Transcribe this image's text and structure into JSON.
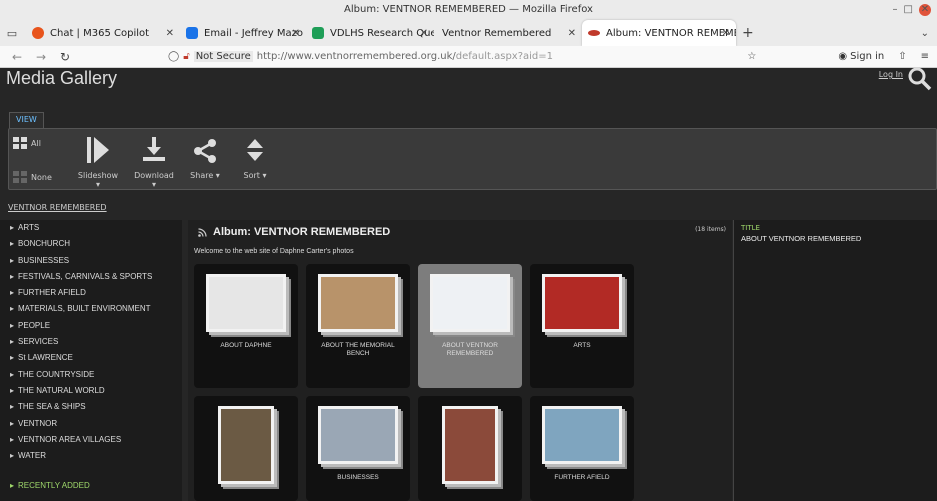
{
  "window": {
    "title": "Album: VENTNOR REMEMBERED — Mozilla Firefox",
    "minimize": "–",
    "maximize": "□",
    "close": "✕"
  },
  "tabs": [
    {
      "label": "Chat | M365 Copilot",
      "color": "#e8541c"
    },
    {
      "label": "Email - Jeffrey Mazo - Outlo",
      "color": "#1a73e8"
    },
    {
      "label": "VDLHS Research Queries - C",
      "color": "#1e9e57"
    },
    {
      "label": "Ventnor Remembered",
      "color": ""
    },
    {
      "label": "Album: VENTNOR REMEMB",
      "color": "#c0392b"
    }
  ],
  "toolbar": {
    "not_secure": "Not Secure",
    "url_domain": "http://www.ventnorremembered.org.uk/",
    "url_path": "default.aspx?aid=1",
    "sign_in": "Sign in"
  },
  "gallery": {
    "title": "Media Gallery",
    "login": "Log In",
    "view_tab": "VIEW"
  },
  "ribbon": {
    "all": "All",
    "none": "None",
    "slideshow": "Slideshow",
    "download": "Download",
    "share": "Share ▾",
    "sort": "Sort ▾"
  },
  "breadcrumb": "VENTNOR REMEMBERED",
  "sidebar": {
    "items": [
      "ARTS",
      "BONCHURCH",
      "BUSINESSES",
      "FESTIVALS, CARNIVALS & SPORTS",
      "FURTHER AFIELD",
      "MATERIALS, BUILT ENVIRONMENT",
      "PEOPLE",
      "SERVICES",
      "St LAWRENCE",
      "THE COUNTRYSIDE",
      "THE NATURAL WORLD",
      "THE SEA & SHIPS",
      "VENTNOR",
      "VENTNOR AREA VILLAGES",
      "WATER"
    ],
    "recent": "RECENTLY ADDED"
  },
  "album": {
    "title": "Album: VENTNOR REMEMBERED",
    "count": "(18 items)",
    "welcome": "Welcome to the web site of Daphne Carter's photos",
    "tiles": [
      {
        "caption": "ABOUT DAPHNE",
        "selected": false,
        "bg": "#e6e6e6"
      },
      {
        "caption": "ABOUT THE MEMORIAL BENCH",
        "selected": false,
        "bg": "#b8936a"
      },
      {
        "caption": "ABOUT VENTNOR REMEMBERED",
        "selected": true,
        "bg": "#eef1f4"
      },
      {
        "caption": "ARTS",
        "selected": false,
        "bg": "#b22a25"
      },
      {
        "caption": "",
        "selected": false,
        "bg": "#6b5a44"
      },
      {
        "caption": "BUSINESSES",
        "selected": false,
        "bg": "#9aa7b5"
      },
      {
        "caption": "",
        "selected": false,
        "bg": "#8b4a3a"
      },
      {
        "caption": "FURTHER AFIELD",
        "selected": false,
        "bg": "#7fa5bf"
      }
    ]
  },
  "details": {
    "label": "TITLE",
    "value": "ABOUT VENTNOR REMEMBERED"
  }
}
